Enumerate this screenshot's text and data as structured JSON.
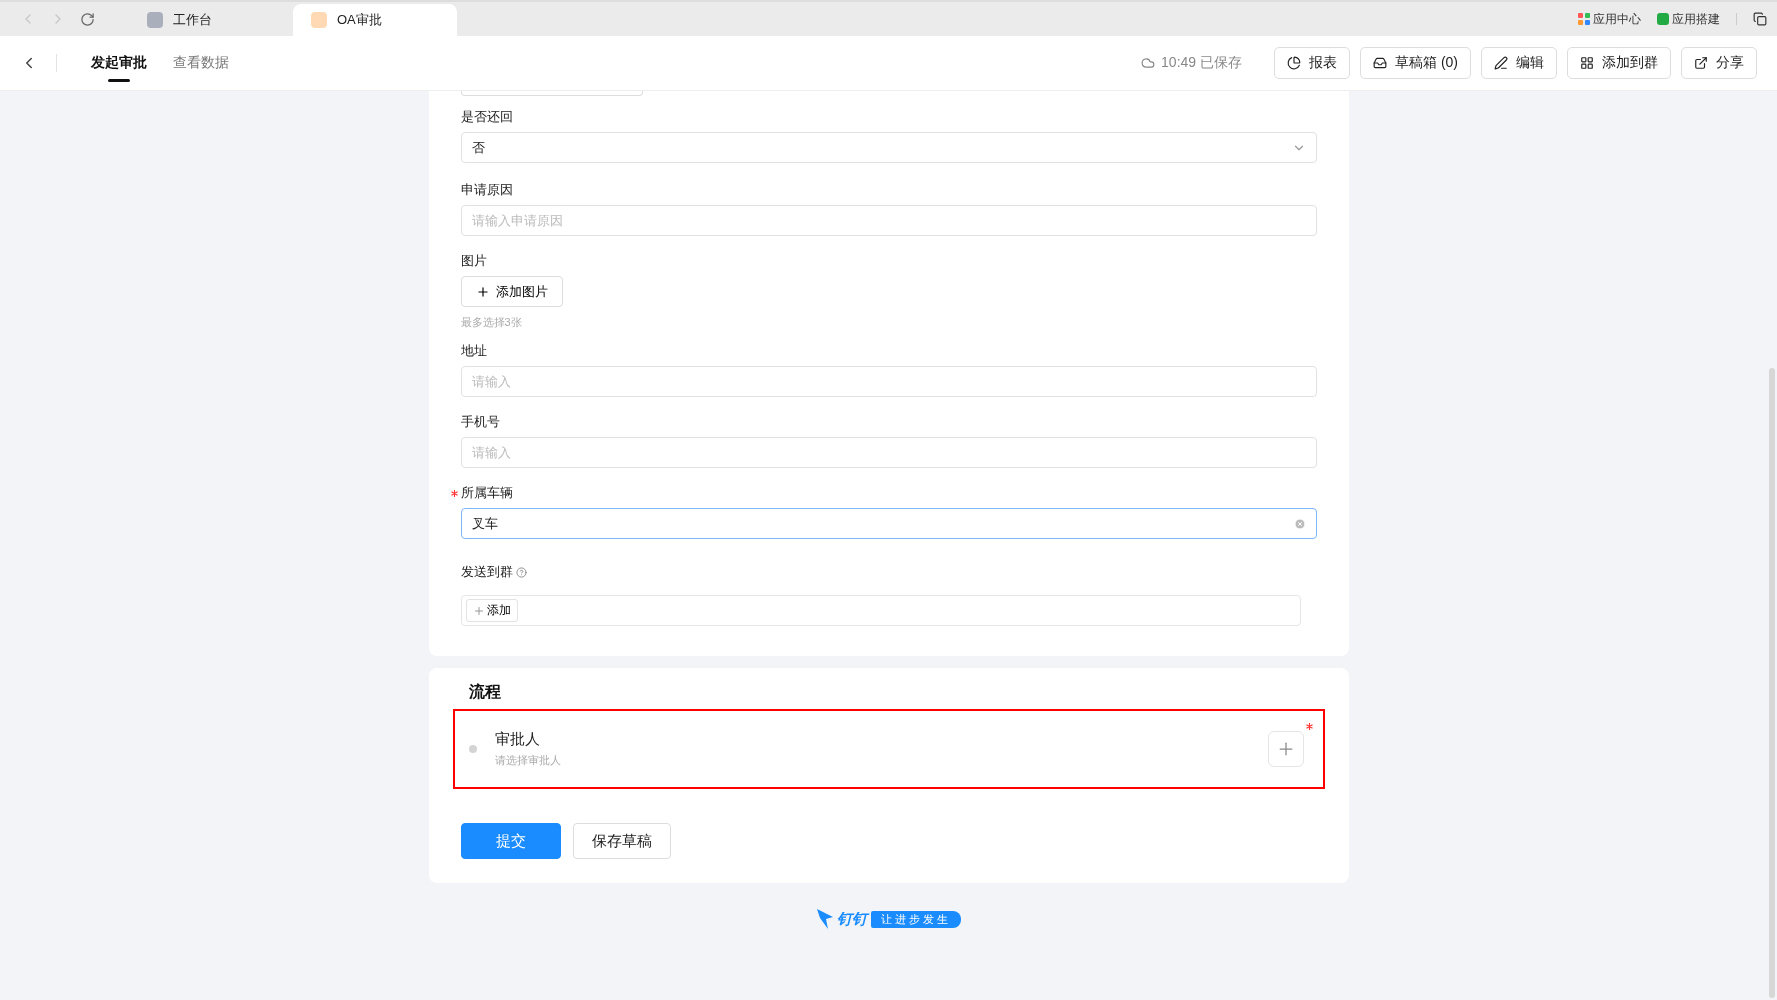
{
  "browser": {
    "tabs": [
      {
        "label": "工作台",
        "selected": false
      },
      {
        "label": "OA审批",
        "selected": true
      }
    ],
    "links": [
      {
        "label": "应用中心"
      },
      {
        "label": "应用搭建"
      }
    ]
  },
  "header": {
    "tabs": [
      {
        "label": "发起审批",
        "selected": true
      },
      {
        "label": "查看数据",
        "selected": false
      }
    ],
    "save_status": "10:49 已保存",
    "buttons": [
      {
        "kind": "report",
        "label": "报表"
      },
      {
        "kind": "drafts",
        "label": "草稿箱 (0)"
      },
      {
        "kind": "edit",
        "label": "编辑"
      },
      {
        "kind": "group",
        "label": "添加到群"
      },
      {
        "kind": "share",
        "label": "分享"
      }
    ]
  },
  "form": {
    "fields": [
      {
        "kind": "select",
        "label": "是否还回",
        "value": "否",
        "required": false
      },
      {
        "kind": "input",
        "label": "申请原因",
        "placeholder": "请输入申请原因",
        "required": false
      },
      {
        "kind": "upload",
        "label": "图片",
        "button": "添加图片",
        "hint": "最多选择3张",
        "required": false
      },
      {
        "kind": "input",
        "label": "地址",
        "placeholder": "请输入",
        "required": false
      },
      {
        "kind": "input",
        "label": "手机号",
        "placeholder": "请输入",
        "required": false
      },
      {
        "kind": "input",
        "label": "所属车辆",
        "value": "叉车",
        "required": true,
        "focused": true
      },
      {
        "kind": "groups",
        "label": "发送到群",
        "button": "添加",
        "required": false
      }
    ]
  },
  "process": {
    "title": "流程",
    "approver": {
      "label": "审批人",
      "placeholder": "请选择审批人",
      "error": true,
      "required": true
    },
    "actions": [
      {
        "kind": "primary",
        "label": "提交"
      },
      {
        "kind": "default",
        "label": "保存草稿"
      }
    ]
  },
  "footer": {
    "brand": "钉钉",
    "slogan": "让进步发生"
  }
}
